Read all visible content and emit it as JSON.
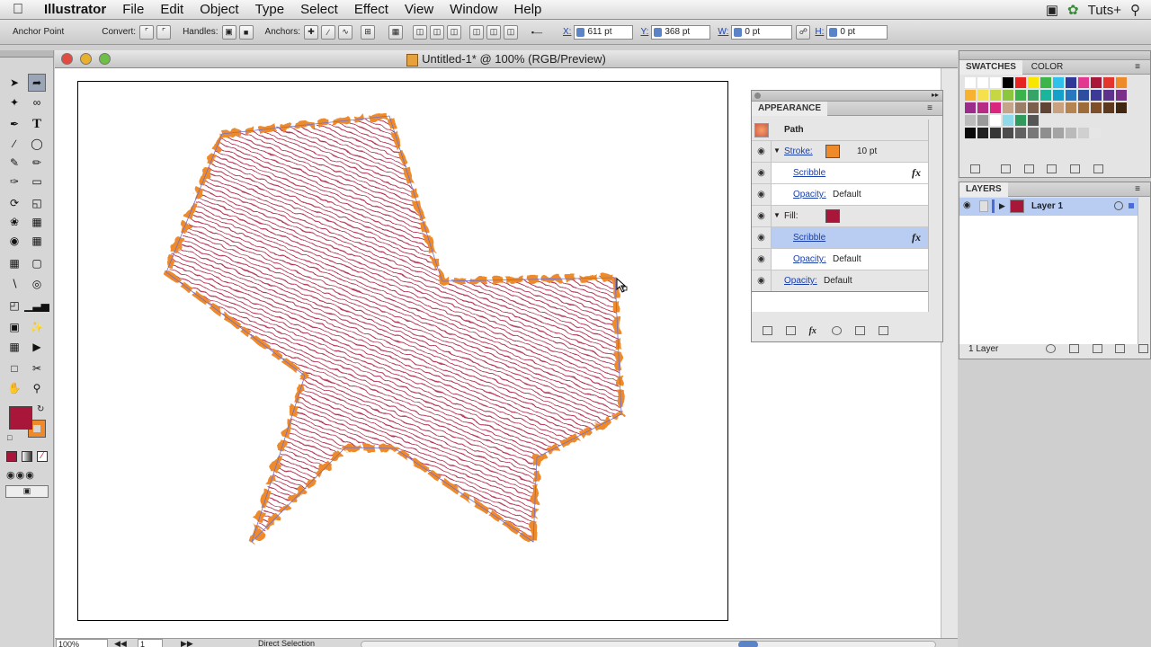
{
  "menubar": {
    "app": "Illustrator",
    "items": [
      "File",
      "Edit",
      "Object",
      "Type",
      "Select",
      "Effect",
      "View",
      "Window",
      "Help"
    ],
    "right_brand": "Tuts+"
  },
  "controlbar": {
    "tool_label": "Anchor Point",
    "convert_label": "Convert:",
    "handles_label": "Handles:",
    "anchors_label": "Anchors:",
    "x_label": "X:",
    "x_value": "611 pt",
    "y_label": "Y:",
    "y_value": "368 pt",
    "w_label": "W:",
    "w_value": "0 pt",
    "h_label": "H:",
    "h_value": "0 pt"
  },
  "document": {
    "title": "Untitled-1* @ 100% (RGB/Preview)",
    "zoom": "100%",
    "page": "1",
    "status": "Direct Selection"
  },
  "appearance": {
    "tab": "APPEARANCE",
    "object": "Path",
    "stroke_label": "Stroke:",
    "stroke_weight": "10 pt",
    "stroke_effect": "Scribble",
    "stroke_opacity_label": "Opacity:",
    "stroke_opacity_value": "Default",
    "fill_label": "Fill:",
    "fill_effect": "Scribble",
    "fill_opacity_label": "Opacity:",
    "fill_opacity_value": "Default",
    "opacity_label": "Opacity:",
    "opacity_value": "Default",
    "fx": "fx"
  },
  "swatches": {
    "tab1": "SWATCHES",
    "tab2": "COLOR"
  },
  "layers": {
    "tab": "LAYERS",
    "layer1": "Layer 1",
    "count": "1 Layer"
  },
  "colors": {
    "fill": "#a8173a",
    "stroke": "#ef8a2a",
    "selection": "#b9cdf2"
  }
}
